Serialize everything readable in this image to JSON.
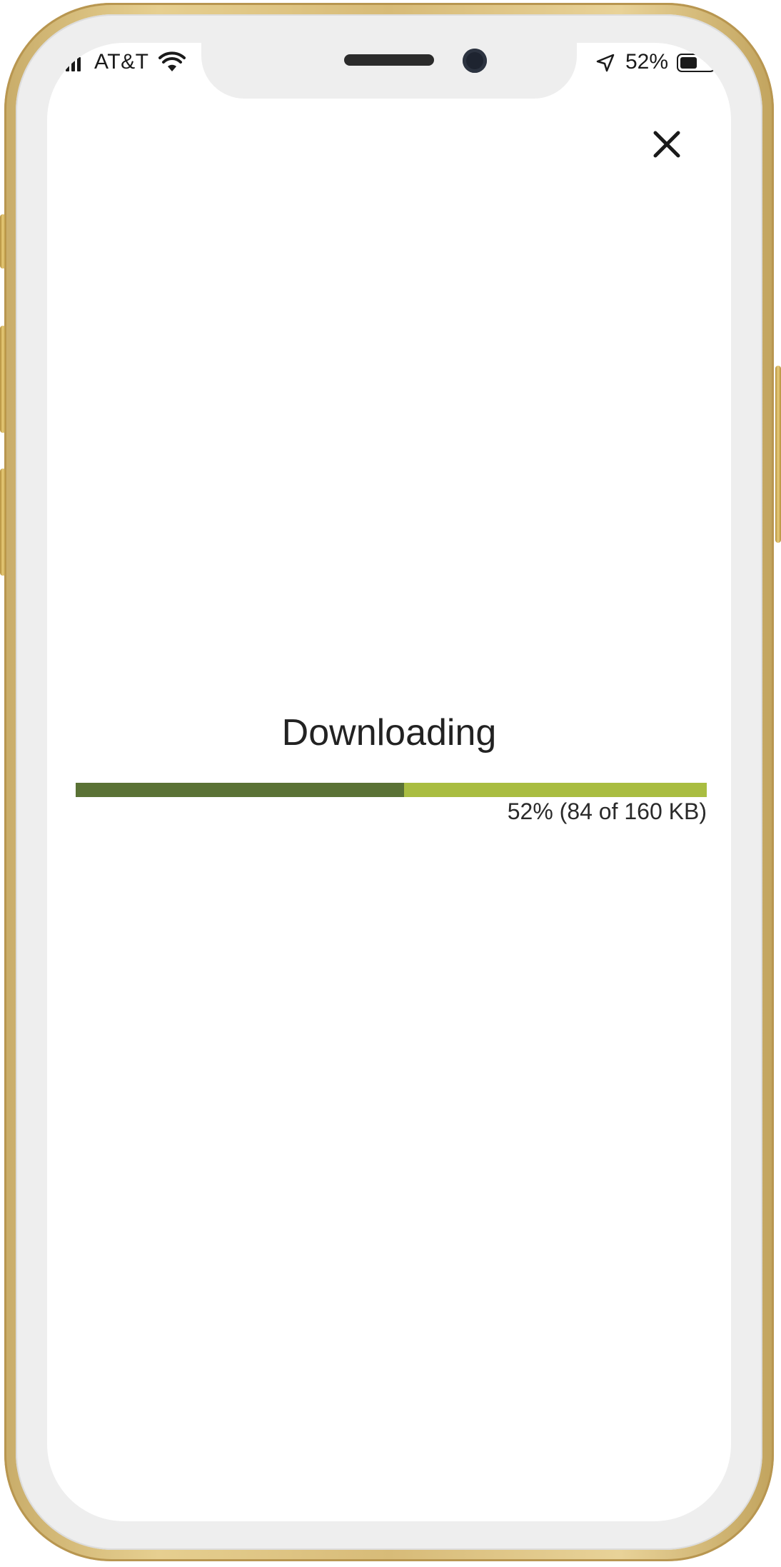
{
  "status_bar": {
    "carrier": "AT&T",
    "battery_percent": "52%",
    "battery_level": 0.52,
    "signal_bars_visible": 3
  },
  "download": {
    "title": "Downloading",
    "progress_fraction": 0.52,
    "progress_text": "52% (84 of 160 KB)"
  },
  "icons": {
    "close": "close-icon",
    "wifi": "wifi-icon",
    "location": "location-arrow-icon",
    "signal": "signal-icon",
    "battery": "battery-icon"
  },
  "colors": {
    "progress_fill": "#5a7235",
    "progress_track": "#a9bd41",
    "frame_gold": "#d7bb78"
  }
}
